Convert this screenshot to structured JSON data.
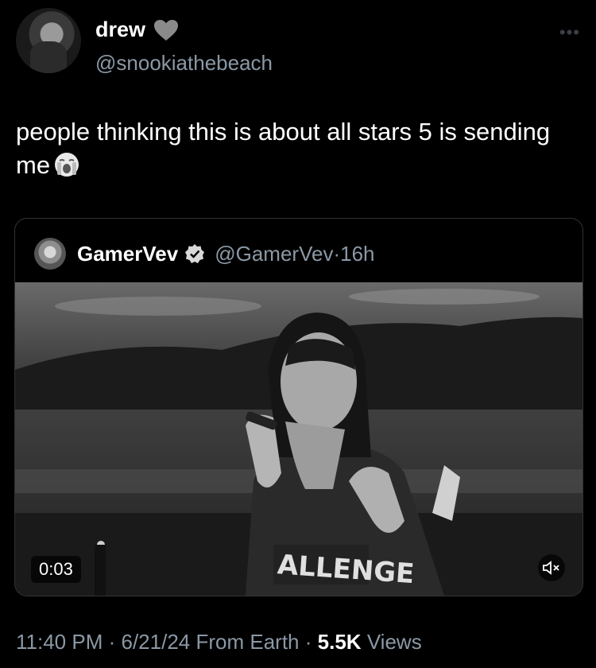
{
  "author": {
    "display_name": "drew",
    "handle": "@snookiathebeach"
  },
  "tweet": {
    "text": "people thinking this is about all stars 5 is sending me"
  },
  "quoted": {
    "display_name": "GamerVev",
    "handle": "@GamerVev",
    "separator": "·",
    "time": "16h",
    "video_time": "0:03"
  },
  "meta": {
    "time": "11:40 PM",
    "dot1": "·",
    "date": "6/21/24",
    "source": "From Earth",
    "dot2": "·",
    "views": "5.5K",
    "views_label": "Views"
  },
  "colors": {
    "background": "#000000",
    "text": "#e7e9ea",
    "muted": "#8b98a5",
    "border": "#2f3336",
    "heart": "#8a8a8a"
  },
  "icons": [
    "grey-heart-icon",
    "more-icon",
    "loudly-crying-face-icon",
    "verified-badge-icon",
    "mute-icon"
  ]
}
